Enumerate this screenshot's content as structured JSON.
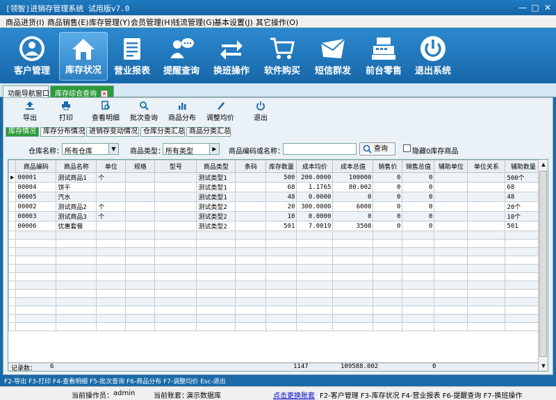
{
  "window": {
    "title": "[领智]进销存管理系统 试用版v7.0",
    "buttons": [
      "—",
      "□",
      "✕"
    ]
  },
  "menu": [
    "商品进货(I)",
    "商品销售(E)",
    "库存管理(Y)",
    "会员管理(H)",
    "钱流管理(G)",
    "基本设置(J)",
    "其它操作(O)"
  ],
  "toolbar": [
    {
      "label": "客户管理",
      "icon": "customer-icon"
    },
    {
      "label": "库存状况",
      "icon": "home-icon",
      "active": true
    },
    {
      "label": "营业报表",
      "icon": "report-icon"
    },
    {
      "label": "提醒查询",
      "icon": "chat-icon"
    },
    {
      "label": "换班操作",
      "icon": "exchange-icon"
    },
    {
      "label": "软件购买",
      "icon": "cart-icon"
    },
    {
      "label": "短信群发",
      "icon": "mail-icon"
    },
    {
      "label": "前台零售",
      "icon": "register-icon"
    },
    {
      "label": "退出系统",
      "icon": "power-icon"
    }
  ],
  "doc_tabs": [
    "功能导航窗口",
    "库存综合查询"
  ],
  "actions": [
    {
      "label": "导出",
      "icon": "export-icon"
    },
    {
      "label": "打印",
      "icon": "print-icon"
    },
    {
      "label": "查看明细",
      "icon": "detail-icon"
    },
    {
      "label": "批次查询",
      "icon": "batch-search-icon"
    },
    {
      "label": "商品分布",
      "icon": "distribution-icon"
    },
    {
      "label": "调整均价",
      "icon": "adjust-icon"
    },
    {
      "label": "退出",
      "icon": "exit-icon"
    }
  ],
  "sub_tabs": [
    "库存情况",
    "库存分布情况",
    "进销存变动情况",
    "仓库分类汇总",
    "商品分类汇总"
  ],
  "filter": {
    "warehouse_label": "仓库名称：",
    "warehouse_value": "所有仓库",
    "category_label": "商品类型：",
    "category_value": "所有类型",
    "search_label": "商品编码或名称：",
    "search_value": "",
    "query_button": "查询",
    "hide_zero_label": "隐藏0库存商品"
  },
  "grid": {
    "columns": [
      "商品编码",
      "商品名称",
      "单位",
      "规格",
      "型号",
      "商品类型",
      "条码",
      "库存数量",
      "成本均价",
      "成本总值",
      "销售价",
      "销售总值",
      "辅助单位",
      "单位关系",
      "辅助数量"
    ],
    "rows": [
      [
        "00001",
        "测试商品1",
        "个",
        "",
        "",
        "测试类型1",
        "",
        "500",
        "200.0000",
        "100000",
        "0",
        "0",
        "",
        "",
        "500个"
      ],
      [
        "00004",
        "饼干",
        "",
        "",
        "",
        "测试类型1",
        "",
        "68",
        "1.1765",
        "80.002",
        "0",
        "0",
        "",
        "",
        "68"
      ],
      [
        "00005",
        "汽水",
        "",
        "",
        "",
        "测试类型1",
        "",
        "48",
        "0.0000",
        "0",
        "0",
        "0",
        "",
        "",
        "48"
      ],
      [
        "00002",
        "测试商品2",
        "个",
        "",
        "",
        "测试类型2",
        "",
        "20",
        "300.0000",
        "6000",
        "0",
        "0",
        "",
        "",
        "20个"
      ],
      [
        "00003",
        "测试商品3",
        "个",
        "",
        "",
        "测试类型2",
        "",
        "10",
        "0.0000",
        "0",
        "0",
        "0",
        "",
        "",
        "10个"
      ],
      [
        "00006",
        "优惠套餐",
        "",
        "",
        "",
        "测试类型2",
        "",
        "501",
        "7.0019",
        "3508",
        "0",
        "0",
        "",
        "",
        "501"
      ]
    ],
    "footer": {
      "count_label": "记录数：",
      "count": "6",
      "total_qty": "1147",
      "total_cost": "109588.002",
      "total_sales": "0"
    }
  },
  "hotkeys": "F2-导出 F3-打印 F4-查看明细 F5-批次查询 F6-商品分布 F7-调整均价 Esc-退出",
  "status": {
    "operator_label": "当前操作员：",
    "operator": "admin",
    "account_label": "当前账套：",
    "account": "演示数据库",
    "switch_link": "点击更换账套",
    "shortcuts": "F2-客户管理 F3-库存状况 F4-营业报表 F6-提醒查询 F7-换班操作"
  },
  "colors": {
    "primary_blue": "#1a6aa8",
    "active_green": "#2e9a3a"
  }
}
